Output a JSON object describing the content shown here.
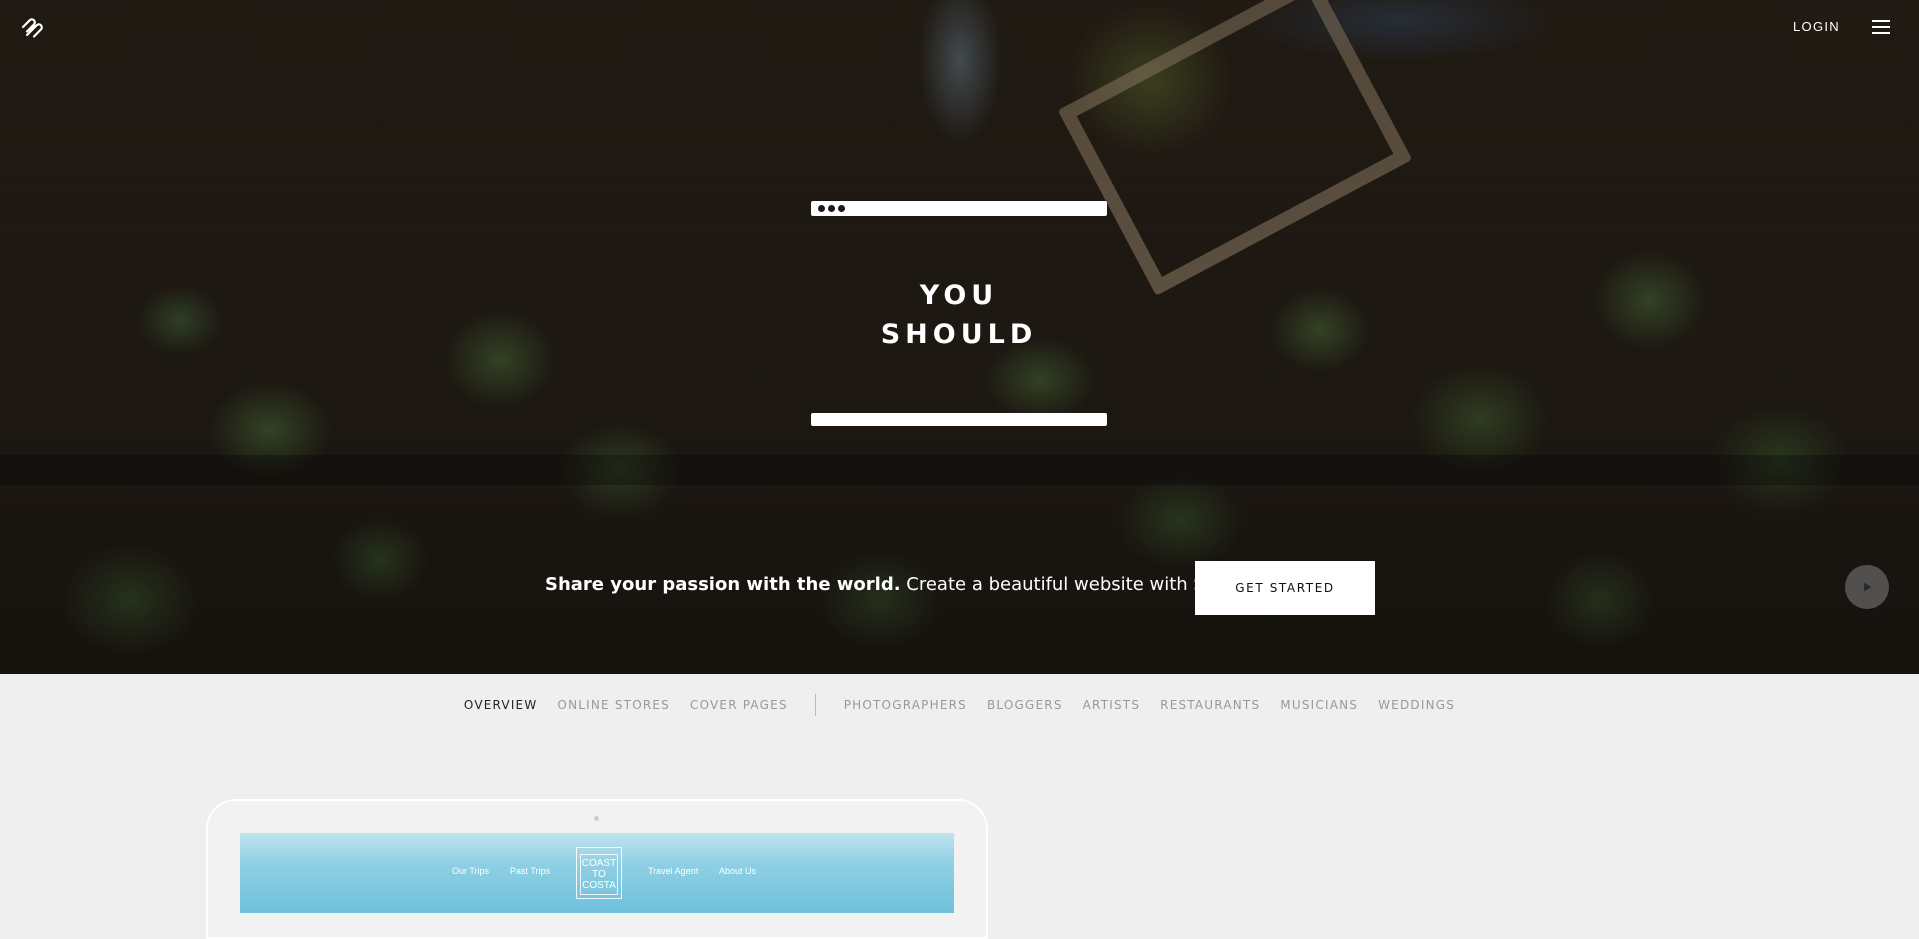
{
  "header": {
    "logo_icon": "squarespace-logo-icon",
    "login_label": "LOGIN",
    "menu_icon": "hamburger-menu-icon"
  },
  "hero": {
    "headline_line1": "YOU",
    "headline_line2": "SHOULD",
    "tagline_bold": "Share your passion with the world.",
    "tagline_rest": " Create a beautiful website with Squarespace.",
    "cta_label": "GET STARTED",
    "play_icon": "play-icon"
  },
  "nav": {
    "primary": [
      {
        "label": "OVERVIEW",
        "active": true
      },
      {
        "label": "ONLINE STORES",
        "active": false
      },
      {
        "label": "COVER PAGES",
        "active": false
      }
    ],
    "secondary": [
      {
        "label": "PHOTOGRAPHERS"
      },
      {
        "label": "BLOGGERS"
      },
      {
        "label": "ARTISTS"
      },
      {
        "label": "RESTAURANTS"
      },
      {
        "label": "MUSICIANS"
      },
      {
        "label": "WEDDINGS"
      }
    ]
  },
  "preview": {
    "links": [
      "Our Trips",
      "Past Trips",
      "Travel Agent",
      "About Us"
    ],
    "site_logo_line1": "COAST",
    "site_logo_line2": "TO",
    "site_logo_line3": "COSTA"
  }
}
